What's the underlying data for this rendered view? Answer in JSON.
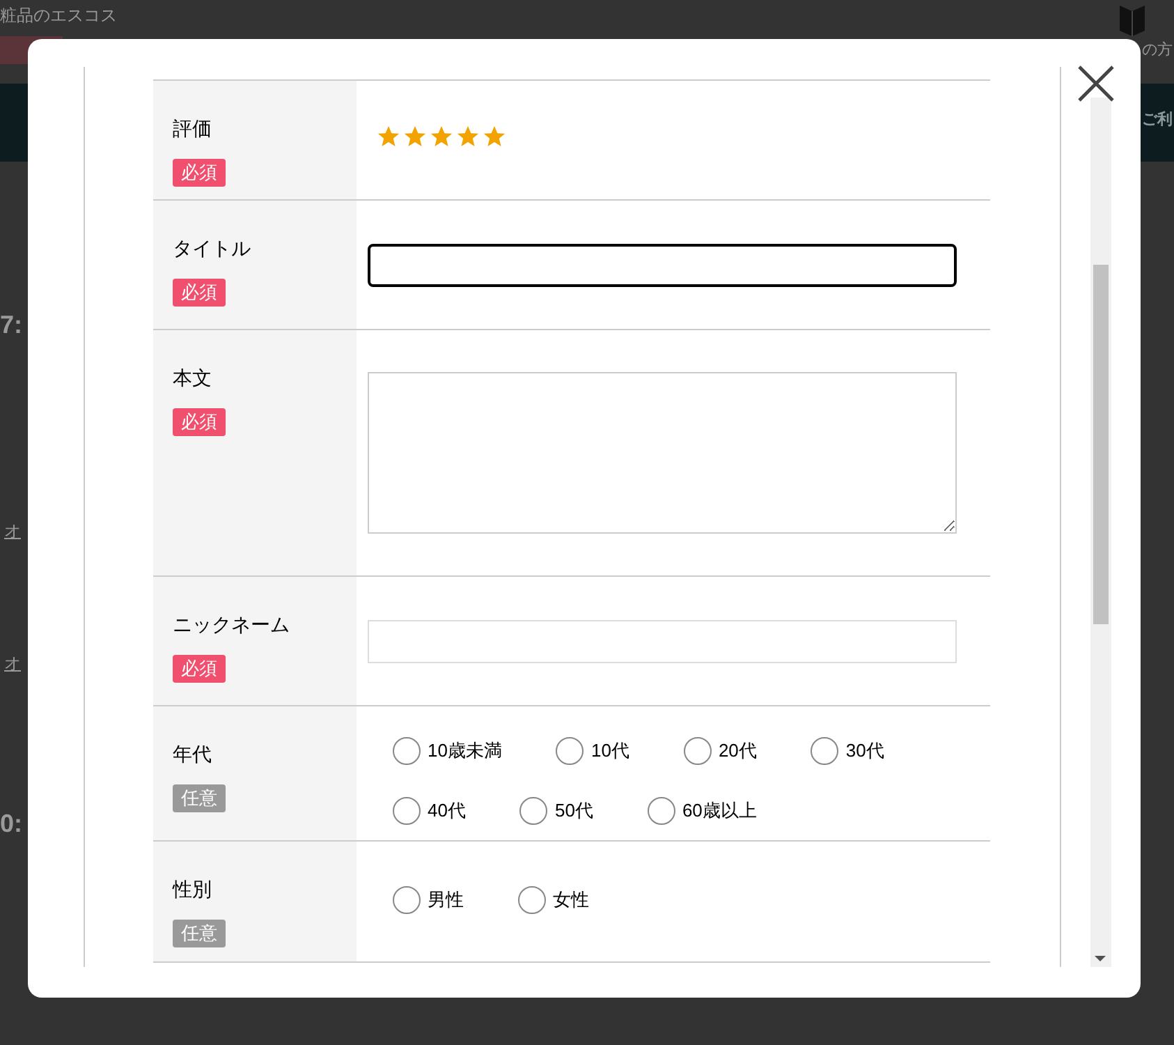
{
  "background_page": {
    "header_text": "粧品のエスコス",
    "header_link": "の方",
    "nav_text": "ご利",
    "row_links": [
      "オ",
      "オ"
    ],
    "row_texts": [
      "7:",
      "0:"
    ]
  },
  "review_form": {
    "rows": [
      {
        "label": "評価",
        "badge": "必須",
        "required": true,
        "kind": "stars",
        "stars": 5
      },
      {
        "label": "タイトル",
        "badge": "必須",
        "required": true,
        "kind": "input",
        "focused": true
      },
      {
        "label": "本文",
        "badge": "必須",
        "required": true,
        "kind": "textarea"
      },
      {
        "label": "ニックネーム",
        "badge": "必須",
        "required": true,
        "kind": "input",
        "focused": false
      },
      {
        "label": "年代",
        "badge": "任意",
        "required": false,
        "kind": "radios",
        "options": [
          {
            "label": "10歳未満",
            "selected": false
          },
          {
            "label": "10代",
            "selected": false
          },
          {
            "label": "20代",
            "selected": false
          },
          {
            "label": "30代",
            "selected": false
          },
          {
            "label": "40代",
            "selected": false
          },
          {
            "label": "50代",
            "selected": false
          },
          {
            "label": "60歳以上",
            "selected": false
          }
        ]
      },
      {
        "label": "性別",
        "badge": "任意",
        "required": false,
        "kind": "radios",
        "options": [
          {
            "label": "男性",
            "selected": false
          },
          {
            "label": "女性",
            "selected": false
          }
        ]
      }
    ]
  }
}
